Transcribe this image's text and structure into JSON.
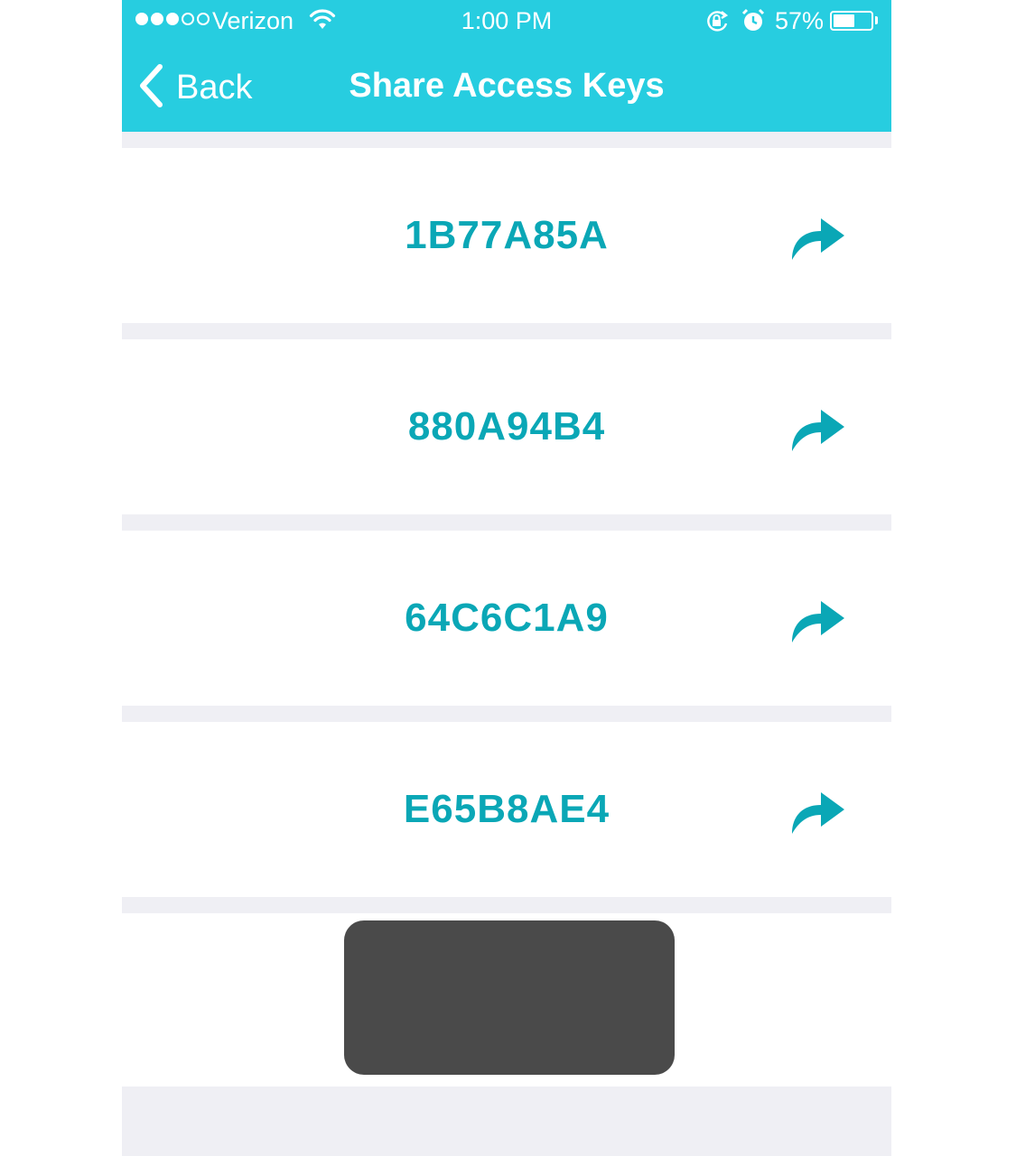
{
  "status_bar": {
    "carrier": "Verizon",
    "time": "1:00 PM",
    "battery_percent": "57%",
    "battery_level": 0.57,
    "signal_bars_filled": 3,
    "signal_bars_total": 5
  },
  "nav": {
    "back_label": "Back",
    "title": "Share Access Keys"
  },
  "keys": [
    {
      "code": "1B77A85A"
    },
    {
      "code": "880A94B4"
    },
    {
      "code": "64C6C1A9"
    },
    {
      "code": "E65B8AE4"
    }
  ],
  "colors": {
    "accent": "#27cde0",
    "key_text": "#0aa7b6",
    "separator": "#efeff4",
    "toast": "#4a4a4a"
  },
  "icons": {
    "share": "share-arrow-icon",
    "back": "chevron-left-icon"
  }
}
